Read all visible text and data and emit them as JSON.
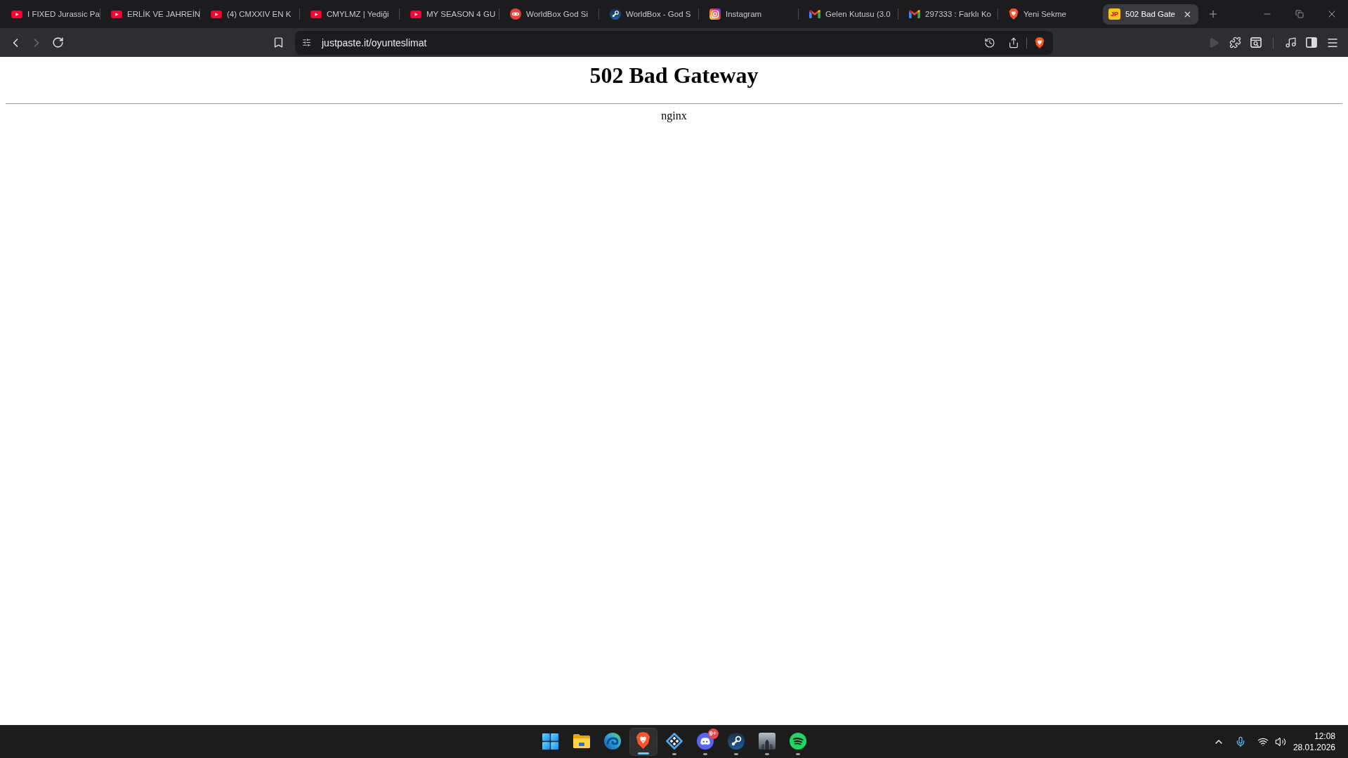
{
  "browser": {
    "tabs": [
      {
        "title": "I FIXED Jurassic Pa",
        "kind": "youtube",
        "selected": false
      },
      {
        "title": "ERLİK VE JAHREİN",
        "kind": "youtube",
        "selected": false
      },
      {
        "title": "(4) CMXXIV EN K",
        "kind": "youtube",
        "selected": false
      },
      {
        "title": "CMYLMZ | Yediği",
        "kind": "youtube",
        "selected": false
      },
      {
        "title": "MY SEASON 4 GU",
        "kind": "youtube",
        "selected": false
      },
      {
        "title": "WorldBox God Si",
        "kind": "gamepad",
        "selected": false
      },
      {
        "title": "WorldBox - God S",
        "kind": "steam",
        "selected": false
      },
      {
        "title": "Instagram",
        "kind": "instagram",
        "selected": false
      },
      {
        "title": "Gelen Kutusu (3.0",
        "kind": "gmail",
        "selected": false
      },
      {
        "title": "297333 : Farklı Ko",
        "kind": "gmail",
        "selected": false
      },
      {
        "title": "Yeni Sekme",
        "kind": "brave",
        "selected": false
      },
      {
        "title": "502 Bad Gate",
        "kind": "logo",
        "logo_text": "JP",
        "selected": true
      }
    ],
    "toolbar": {
      "back_disabled": false,
      "forward_disabled": true,
      "play_disabled": true
    },
    "address_bar": {
      "url": "justpaste.it/oyunteslimat"
    }
  },
  "page": {
    "heading": "502 Bad Gateway",
    "server": "nginx"
  },
  "taskbar": {
    "apps": [
      {
        "kind": "start",
        "active": false,
        "running": false
      },
      {
        "kind": "explorer",
        "active": false,
        "running": false
      },
      {
        "kind": "edge",
        "active": false,
        "running": false
      },
      {
        "kind": "brave",
        "active": true,
        "running": true
      },
      {
        "kind": "lattice",
        "active": false,
        "running": true
      },
      {
        "kind": "discord",
        "active": false,
        "running": true,
        "badge": "9+"
      },
      {
        "kind": "steam",
        "active": false,
        "running": true
      },
      {
        "kind": "game",
        "active": false,
        "running": true
      },
      {
        "kind": "spotify",
        "active": false,
        "running": true
      }
    ],
    "clock": {
      "time": "12:08",
      "date": "28.01.2026"
    }
  }
}
